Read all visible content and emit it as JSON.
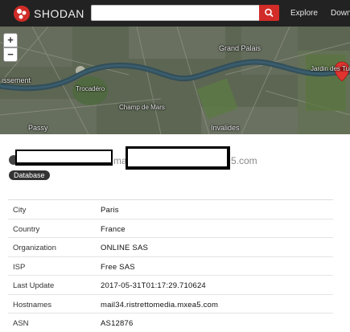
{
  "navbar": {
    "brand": "SHODAN",
    "search": {
      "value": "",
      "placeholder": ""
    },
    "links": [
      "Explore",
      "Downl"
    ]
  },
  "map": {
    "zoom_in": "+",
    "zoom_out": "−",
    "labels": {
      "grand_palais": "Grand Palais",
      "tuileries": "Jardin des Tuileries",
      "trocadero": "Trocadéro",
      "issement": "issement",
      "passy": "Passy",
      "invalides": "Invalides",
      "champ": "Champ de Mars"
    }
  },
  "host": {
    "middle_visible": "ma",
    "domain_suffix": "5.com",
    "tag": "Database"
  },
  "info": [
    {
      "key": "City",
      "value": "Paris"
    },
    {
      "key": "Country",
      "value": "France"
    },
    {
      "key": "Organization",
      "value": "ONLINE SAS"
    },
    {
      "key": "ISP",
      "value": "Free SAS"
    },
    {
      "key": "Last Update",
      "value": "2017-05-31T01:17:29.710624"
    },
    {
      "key": "Hostnames",
      "value": "mail34.ristrettomedia.mxea5.com"
    },
    {
      "key": "ASN",
      "value": "AS12876"
    }
  ],
  "colors": {
    "navbar": "#222222",
    "search_button": "#d12c28",
    "logo": "#d12c28",
    "map_marker": "#e2342f"
  }
}
